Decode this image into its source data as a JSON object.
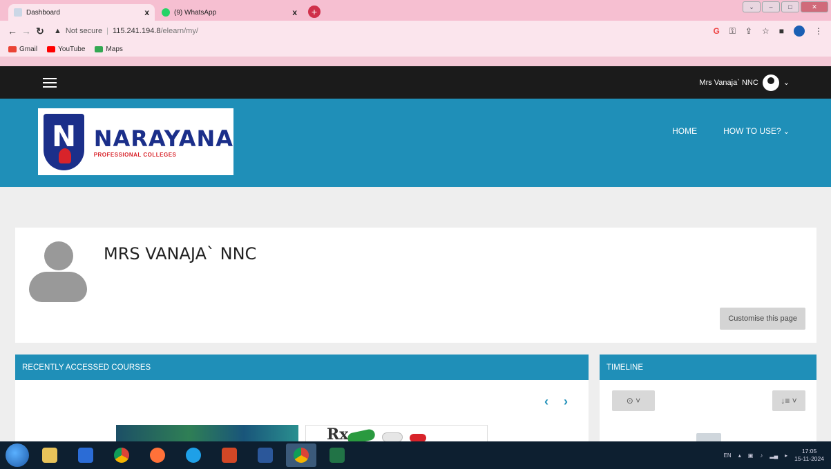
{
  "browser": {
    "tabs": [
      {
        "title": "Dashboard",
        "active": true
      },
      {
        "title": "(9) WhatsApp",
        "active": false
      }
    ],
    "new_tab_symbol": "+",
    "close_symbol": "x",
    "security_label": "Not secure",
    "url_host": "115.241.194.8",
    "url_path": "/elearn/my/",
    "bookmarks": [
      {
        "label": "Gmail",
        "color": "#ea4335"
      },
      {
        "label": "YouTube",
        "color": "#ff0000"
      },
      {
        "label": "Maps",
        "color": "#34a853"
      }
    ]
  },
  "navbar": {
    "user_name": "Mrs Vanaja` NNC",
    "caret": "⌄"
  },
  "brand": {
    "logo_letter": "N",
    "name": "NARAYANA",
    "tagline": "PROFESSIONAL COLLEGES"
  },
  "menu": {
    "home": "HOME",
    "how_to_use": "HOW TO USE?"
  },
  "profile": {
    "full_name": "MRS VANAJA` NNC",
    "customise_button": "Customise this page"
  },
  "blocks": {
    "recent_courses": {
      "title": "RECENTLY ACCESSED COURSES",
      "prev": "‹",
      "next": "›",
      "rx_text": "Rx"
    },
    "timeline": {
      "title": "TIMELINE",
      "filter_label": "⊙ ˅",
      "sort_label": "↓≡ ˅"
    }
  },
  "taskbar": {
    "language": "EN",
    "time": "17:05",
    "date": "15-11-2024"
  },
  "colors": {
    "moodle_blue": "#1f8fb8",
    "navbar_dark": "#1b1b1b",
    "brand_navy": "#1b2f8a",
    "brand_red": "#d8232a"
  }
}
